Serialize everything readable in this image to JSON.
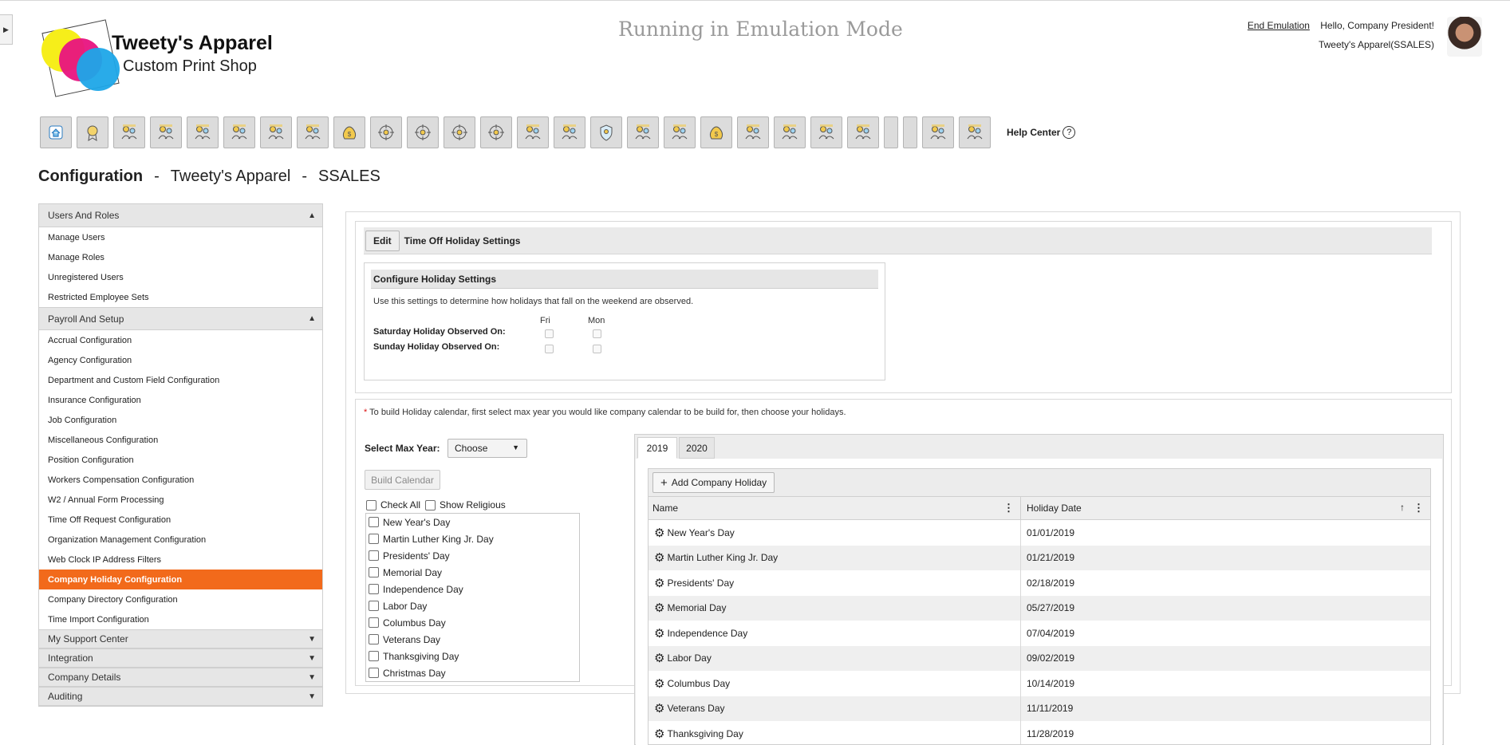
{
  "header": {
    "company_name": "Tweety's Apparel",
    "company_sub": "Custom Print Shop",
    "emulation_title": "Running in Emulation Mode",
    "end_emulation": "End Emulation",
    "greeting": "Hello, Company President!",
    "account": "Tweety's Apparel(SSALES)"
  },
  "toolbar": {
    "icons": [
      "home-icon",
      "award-icon",
      "user-settings-icon",
      "presentation-icon",
      "team-icon",
      "org-group-icon",
      "hierarchy-icon",
      "document-icon",
      "money-bag-icon",
      "target-icon",
      "target-icon",
      "target-icon",
      "target-icon",
      "transfer-icon",
      "hand-point-icon",
      "shield-icon",
      "hand-search-icon",
      "user-remove-icon",
      "money-bag-icon",
      "group-chart-icon",
      "hand-point-icon",
      "crowd-icon",
      "hand-search-icon",
      "blank",
      "blank",
      "org-group-icon",
      "certificate-icon"
    ],
    "help_center": "Help Center",
    "help_icon": "?"
  },
  "page_title": {
    "section": "Configuration",
    "sep": "-",
    "company": "Tweety's Apparel",
    "code": "SSALES"
  },
  "sidebar": {
    "users_roles": {
      "title": "Users And Roles",
      "items": [
        "Manage Users",
        "Manage Roles",
        "Unregistered Users",
        "Restricted Employee Sets"
      ]
    },
    "payroll": {
      "title": "Payroll And Setup",
      "items": [
        "Accrual Configuration",
        "Agency Configuration",
        "Department and Custom Field Configuration",
        "Insurance Configuration",
        "Job Configuration",
        "Miscellaneous Configuration",
        "Position Configuration",
        "Workers Compensation Configuration",
        "W2 / Annual Form Processing",
        "Time Off Request Configuration",
        "Organization Management Configuration",
        "Web Clock IP Address Filters",
        "Company Holiday Configuration",
        "Company Directory Configuration",
        "Time Import Configuration"
      ],
      "active_index": 12
    },
    "collapsed": [
      "My Support Center",
      "Integration",
      "Company Details",
      "Auditing"
    ]
  },
  "settings": {
    "edit_label": "Edit",
    "title": "Time Off Holiday Settings",
    "configure_title": "Configure Holiday Settings",
    "description": "Use this settings to determine how holidays that fall on the weekend are observed.",
    "col_fri": "Fri",
    "col_mon": "Mon",
    "saturday_label": "Saturday Holiday Observed On:",
    "sunday_label": "Sunday Holiday Observed On:"
  },
  "calendar": {
    "note_star": "*",
    "note": " To build Holiday calendar, first select max year you would like company calendar to be build for, then choose your holidays.",
    "max_year_label": "Select Max Year:",
    "max_year_value": "Choose",
    "build_label": "Build Calendar",
    "check_all": "Check All",
    "show_religious": "Show Religious",
    "holidays": [
      "New Year's Day",
      "Martin Luther King Jr. Day",
      "Presidents' Day",
      "Memorial Day",
      "Independence Day",
      "Labor Day",
      "Columbus Day",
      "Veterans Day",
      "Thanksgiving Day",
      "Christmas Day"
    ]
  },
  "tabs": {
    "items": [
      "2019",
      "2020"
    ],
    "active": "2019",
    "add_label": "Add Company Holiday",
    "add_icon": "+",
    "col_name": "Name",
    "col_date": "Holiday Date",
    "sort_icon": "↑",
    "menu_icon": "⋮",
    "rows": [
      {
        "name": "New Year's Day",
        "date": "01/01/2019"
      },
      {
        "name": "Martin Luther King Jr. Day",
        "date": "01/21/2019"
      },
      {
        "name": "Presidents' Day",
        "date": "02/18/2019"
      },
      {
        "name": "Memorial Day",
        "date": "05/27/2019"
      },
      {
        "name": "Independence Day",
        "date": "07/04/2019"
      },
      {
        "name": "Labor Day",
        "date": "09/02/2019"
      },
      {
        "name": "Columbus Day",
        "date": "10/14/2019"
      },
      {
        "name": "Veterans Day",
        "date": "11/11/2019"
      },
      {
        "name": "Thanksgiving Day",
        "date": "11/28/2019"
      }
    ]
  },
  "colors": {
    "accent": "#f26a1b",
    "logo_yellow": "#f6ee1a",
    "logo_magenta": "#e8137f",
    "logo_cyan": "#1ea6e8"
  }
}
